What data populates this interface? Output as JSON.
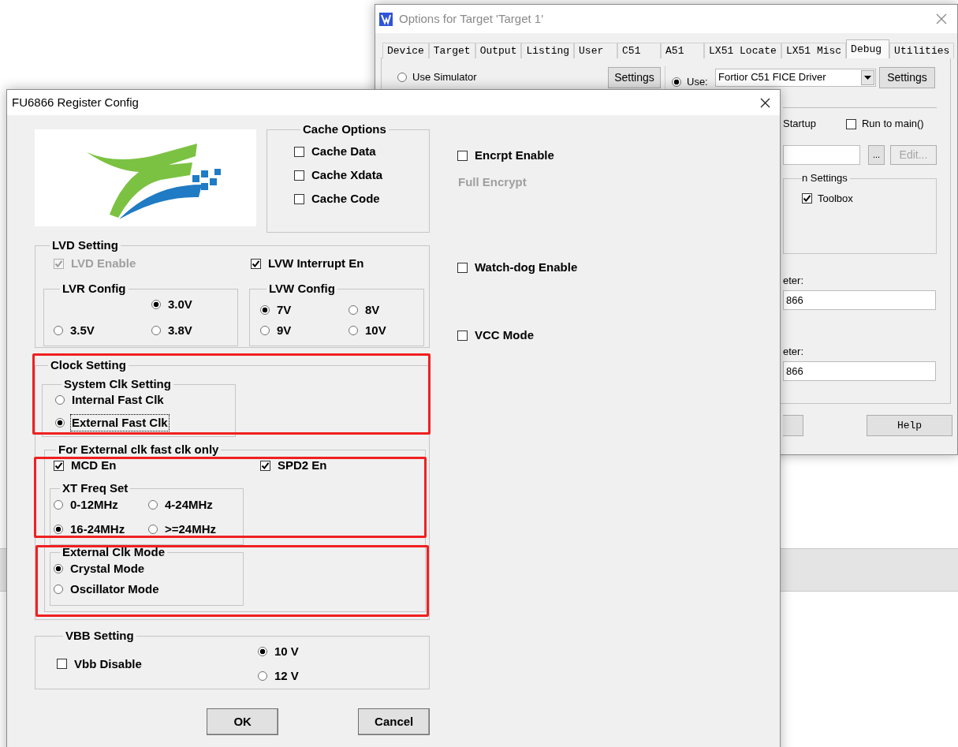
{
  "back_window": {
    "title": "Options for Target 'Target 1'",
    "tabs": [
      {
        "label": "Device",
        "selected": false
      },
      {
        "label": "Target",
        "selected": false
      },
      {
        "label": "Output",
        "selected": false
      },
      {
        "label": "Listing",
        "selected": false
      },
      {
        "label": "User",
        "selected": false
      },
      {
        "label": "C51",
        "selected": false
      },
      {
        "label": "A51",
        "selected": false
      },
      {
        "label": "LX51 Locate",
        "selected": false
      },
      {
        "label": "LX51 Misc",
        "selected": false
      },
      {
        "label": "Debug",
        "selected": true
      },
      {
        "label": "Utilities",
        "selected": false
      }
    ],
    "use_simulator": {
      "label": "Use Simulator",
      "selected": false
    },
    "simulator_settings": "Settings",
    "use_driver": {
      "label": "Use:",
      "selected": true
    },
    "driver": "Fortior C51 FICE Driver",
    "driver_settings": "Settings",
    "startup_label": "Startup",
    "run_to_main": {
      "label": "Run to main()",
      "checked": false
    },
    "browse_button": "...",
    "edit_button": {
      "label": "Edit...",
      "disabled": true
    },
    "settings_group": {
      "title": "n Settings",
      "toolbox": {
        "label": "Toolbox",
        "checked": true
      }
    },
    "parameters": [
      {
        "label": "eter:",
        "value": "866"
      },
      {
        "label": "eter:",
        "value": "866"
      }
    ],
    "help_button": "Help"
  },
  "dialog": {
    "title": "FU6866 Register Config",
    "cache_options": {
      "title": "Cache Options",
      "items": [
        {
          "label": "Cache Data",
          "checked": false
        },
        {
          "label": "Cache Xdata",
          "checked": false
        },
        {
          "label": "Cache Code",
          "checked": false
        }
      ]
    },
    "lvd_setting": {
      "title": "LVD Setting",
      "lvd_enable": {
        "label": "LVD Enable",
        "checked": true,
        "disabled": true
      },
      "lvw_interrupt": {
        "label": "LVW Interrupt En",
        "checked": true,
        "disabled": false
      },
      "lvr_config": {
        "title": "LVR Config",
        "options": [
          {
            "label": "3.0V",
            "selected": true
          },
          {
            "label": "3.5V",
            "selected": false
          },
          {
            "label": "3.8V",
            "selected": false
          }
        ]
      },
      "lvw_config": {
        "title": "LVW Config",
        "options": [
          {
            "label": "7V",
            "selected": true
          },
          {
            "label": "8V",
            "selected": false
          },
          {
            "label": "9V",
            "selected": false
          },
          {
            "label": "10V",
            "selected": false
          }
        ]
      }
    },
    "clock_setting": {
      "title": "Clock Setting",
      "system_clk": {
        "title": "System Clk Setting",
        "options": [
          {
            "label": "Internal Fast Clk",
            "selected": false,
            "focused": false
          },
          {
            "label": "External Fast Clk",
            "selected": true,
            "focused": true
          }
        ]
      },
      "external_only": {
        "title": "For External clk fast clk only",
        "mcd_en": {
          "label": "MCD En",
          "checked": true
        },
        "spd2_en": {
          "label": "SPD2 En",
          "checked": true
        },
        "xt_freq": {
          "title": "XT Freq Set",
          "options": [
            {
              "label": "0-12MHz",
              "selected": false
            },
            {
              "label": "4-24MHz",
              "selected": false
            },
            {
              "label": "16-24MHz",
              "selected": true
            },
            {
              "label": ">=24MHz",
              "selected": false
            }
          ]
        },
        "clk_mode": {
          "title": "External Clk Mode",
          "options": [
            {
              "label": "Crystal Mode",
              "selected": true
            },
            {
              "label": "Oscillator Mode",
              "selected": false
            }
          ]
        }
      }
    },
    "vbb_setting": {
      "title": "VBB Setting",
      "vbb_disable": {
        "label": "Vbb Disable",
        "checked": false
      },
      "options": [
        {
          "label": "10 V",
          "selected": true
        },
        {
          "label": "12 V",
          "selected": false
        }
      ]
    },
    "encrypt_enable": {
      "label": "Encrpt Enable",
      "checked": false
    },
    "full_encrypt": {
      "label": "Full Encrypt",
      "disabled": true
    },
    "watchdog_enable": {
      "label": "Watch-dog Enable",
      "checked": false
    },
    "vcc_mode": {
      "label": "VCC Mode",
      "checked": false
    },
    "buttons": [
      "OK",
      "Cancel"
    ]
  }
}
